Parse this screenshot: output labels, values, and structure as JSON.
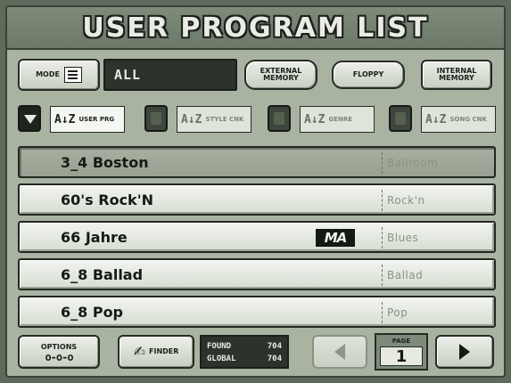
{
  "title": "USER PROGRAM LIST",
  "toolbar": {
    "mode_label": "MODE",
    "mode_value": "ALL",
    "external_memory_label": "EXTERNAL MEMORY",
    "floppy_label": "FLOPPY",
    "internal_memory_label": "INTERNAL MEMORY"
  },
  "sort": [
    {
      "label": "USER PRG",
      "active": true
    },
    {
      "label": "STYLE CNK",
      "active": false
    },
    {
      "label": "GENRE",
      "active": false
    },
    {
      "label": "SONG CNK",
      "active": false
    }
  ],
  "sort_glyph": "A↓Z",
  "programs": [
    {
      "name": "3_4 Boston",
      "style": "Ballroom",
      "selected": true,
      "badge": ""
    },
    {
      "name": "60's Rock'N",
      "style": "Rock'n",
      "selected": false,
      "badge": ""
    },
    {
      "name": "66 Jahre",
      "style": "Blues",
      "selected": false,
      "badge": "MA"
    },
    {
      "name": "6_8 Ballad",
      "style": "Ballad",
      "selected": false,
      "badge": ""
    },
    {
      "name": "6_8 Pop",
      "style": "Pop",
      "selected": false,
      "badge": ""
    }
  ],
  "bottom": {
    "options_label": "OPTIONS",
    "options_glyph": "o-o-o",
    "finder_label": "FINDER",
    "found_label": "FOUND",
    "found_value": "704",
    "global_label": "GLOBAL",
    "global_value": "704",
    "page_label": "PAGE",
    "page_value": "1"
  },
  "colors": {
    "lcd_background": "#a9b3a2",
    "lcd_dark": "#2d332c",
    "row_light": "#f2f4ef"
  }
}
